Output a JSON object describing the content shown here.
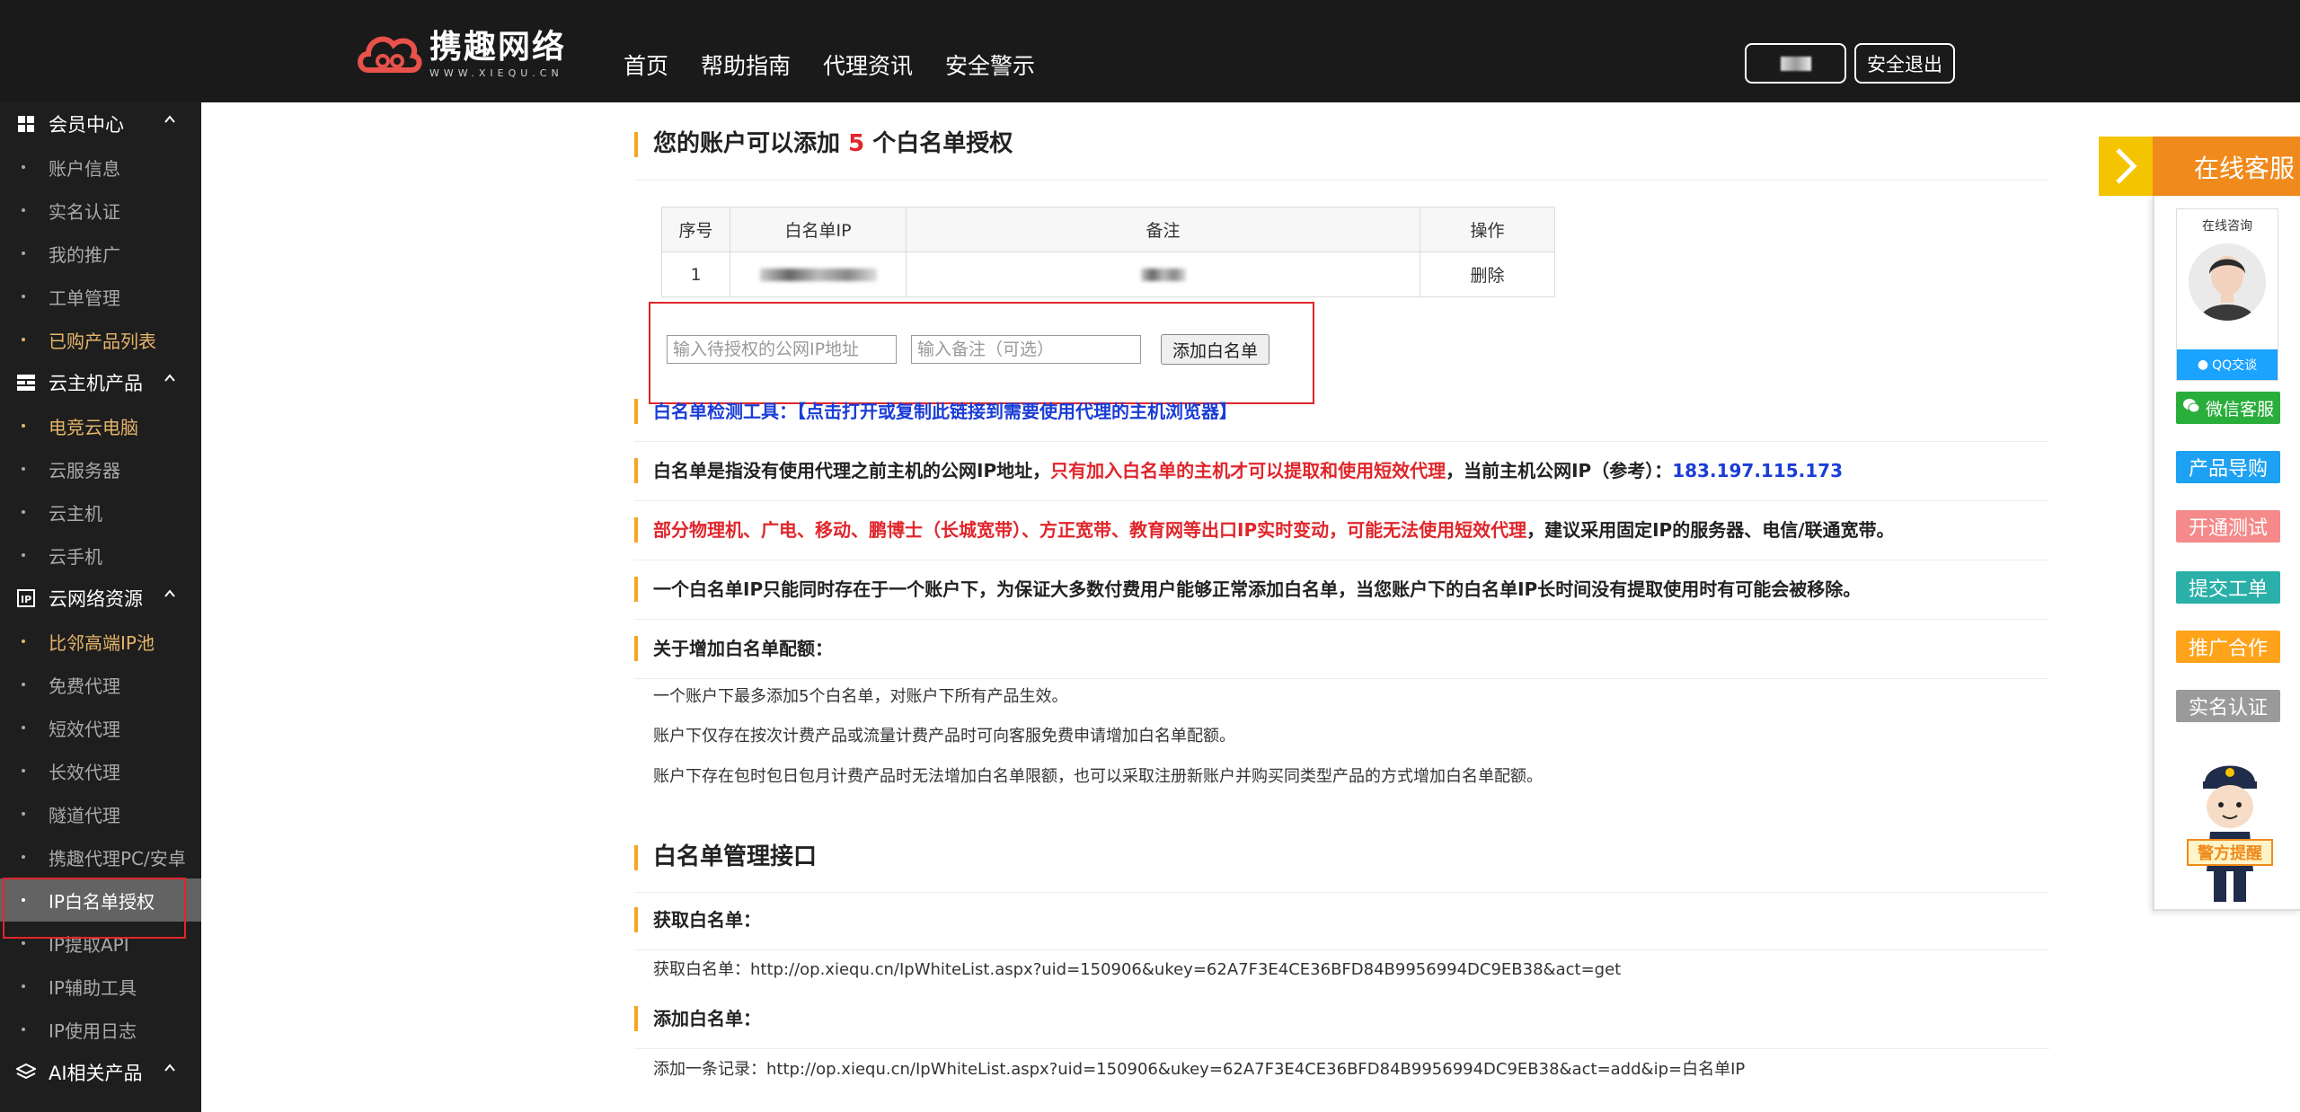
{
  "brand": {
    "name_cn": "携趣网络",
    "name_en": "WWW.XIEQU.CN"
  },
  "topnav": [
    "首页",
    "帮助指南",
    "代理资讯",
    "安全警示"
  ],
  "header": {
    "logout_label": "安全退出"
  },
  "sidebar": {
    "groups": [
      {
        "title": "会员中心",
        "icon": "grid-icon",
        "items": [
          {
            "label": "账户信息"
          },
          {
            "label": "实名认证"
          },
          {
            "label": "我的推广"
          },
          {
            "label": "工单管理"
          },
          {
            "label": "已购产品列表",
            "style": "gold"
          }
        ]
      },
      {
        "title": "云主机产品",
        "icon": "server-icon",
        "items": [
          {
            "label": "电竞云电脑",
            "style": "gold"
          },
          {
            "label": "云服务器"
          },
          {
            "label": "云主机"
          },
          {
            "label": "云手机"
          }
        ]
      },
      {
        "title": "云网络资源",
        "icon": "ip-icon",
        "items": [
          {
            "label": "比邻高端IP池",
            "style": "gold"
          },
          {
            "label": "免费代理"
          },
          {
            "label": "短效代理"
          },
          {
            "label": "长效代理"
          },
          {
            "label": "隧道代理"
          },
          {
            "label": "携趣代理PC/安卓"
          },
          {
            "label": "IP白名单授权",
            "style": "active"
          },
          {
            "label": "IP提取API"
          },
          {
            "label": "IP辅助工具"
          },
          {
            "label": "IP使用日志"
          }
        ]
      },
      {
        "title": "AI相关产品",
        "icon": "layers-icon",
        "items": []
      }
    ]
  },
  "main": {
    "title_prefix": "您的账户可以添加",
    "title_count": "5",
    "title_suffix": "个白名单授权",
    "table": {
      "headers": [
        "序号",
        "白名单IP",
        "备注",
        "操作"
      ],
      "rows": [
        {
          "index": "1",
          "action": "删除"
        }
      ]
    },
    "add": {
      "ip_placeholder": "输入待授权的公网IP地址",
      "note_placeholder": "输入备注（可选）",
      "button": "添加白名单"
    },
    "tool_link": "白名单检测工具：【点击打开或复制此链接到需要使用代理的主机浏览器】",
    "info1_a": "白名单是指没有使用代理之前主机的公网IP地址，",
    "info1_b": "只有加入白名单的主机才可以提取和使用短效代理",
    "info1_c": "，当前主机公网IP（参考）：",
    "info1_ip": "183.197.115.173",
    "info2_a": "部分物理机、广电、移动、鹏博士（长城宽带）、方正宽带、教育网等出口IP实时变动，可能无法使用短效代理",
    "info2_b": "，建议采用固定IP的服务器、电信/联通宽带。",
    "info3": "一个白名单IP只能同时存在于一个账户下，为保证大多数付费用户能够正常添加白名单，当您账户下的白名单IP长时间没有提取使用时有可能会被移除。",
    "quota_title": "关于增加白名单配额：",
    "quota_lines": [
      "一个账户下最多添加5个白名单，对账户下所有产品生效。",
      "账户下仅存在按次计费产品或流量计费产品时可向客服免费申请增加白名单配额。",
      "账户下存在包时包日包月计费产品时无法增加白名单限额，也可以采取注册新账户并购买同类型产品的方式增加白名单配额。"
    ],
    "api_title": "白名单管理接口",
    "get_title": "获取白名单：",
    "get_line": "获取白名单：http://op.xiequ.cn/IpWhiteList.aspx?uid=150906&ukey=62A7F3E4CE36BFD84B9956994DC9EB38&act=get",
    "add_title": "添加白名单：",
    "add_line": "添加一条记录：http://op.xiequ.cn/IpWhiteList.aspx?uid=150906&ukey=62A7F3E4CE36BFD84B9956994DC9EB38&act=add&ip=白名单IP"
  },
  "float": {
    "cs_title": "在线客服",
    "consult": "在线咨询",
    "qq": "QQ交谈",
    "buttons": [
      {
        "label": "微信客服",
        "color": "#2aae3b",
        "icon": "wechat-icon"
      },
      {
        "label": "产品导购",
        "color": "#1da1f2"
      },
      {
        "label": "开通测试",
        "color": "#f58a8a"
      },
      {
        "label": "提交工单",
        "color": "#2ab0a8"
      },
      {
        "label": "推广合作",
        "color": "#ffa31a"
      },
      {
        "label": "实名认证",
        "color": "#9a9a9a"
      }
    ],
    "police": "警方提醒"
  }
}
